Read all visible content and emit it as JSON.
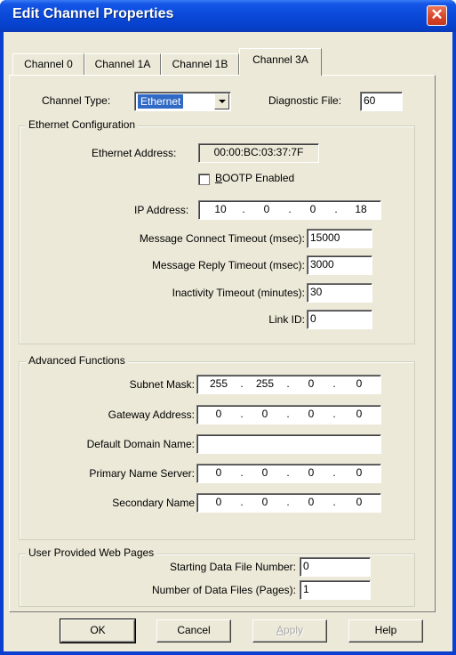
{
  "window": {
    "title": "Edit Channel Properties",
    "close_glyph": "✕"
  },
  "tabs": [
    {
      "label": "Channel 0"
    },
    {
      "label": "Channel 1A"
    },
    {
      "label": "Channel 1B"
    },
    {
      "label": "Channel 3A"
    }
  ],
  "channel": {
    "type_label": "Channel Type:",
    "type_value": "Ethernet",
    "diag_label": "Diagnostic File:",
    "diag_value": "60"
  },
  "ethernet": {
    "group_title": "Ethernet Configuration",
    "address_label": "Ethernet Address:",
    "address_value": "00:00:BC:03:37:7F",
    "bootp_first": "B",
    "bootp_rest": "OOTP Enabled",
    "bootp_checked": false,
    "ip_label": "IP Address:",
    "ip": [
      "10",
      "0",
      "0",
      "18"
    ],
    "connect_label": "Message Connect Timeout (msec):",
    "connect_value": "15000",
    "reply_label": "Message Reply Timeout (msec):",
    "reply_value": "3000",
    "inactivity_label": "Inactivity Timeout (minutes):",
    "inactivity_value": "30",
    "link_label": "Link ID:",
    "link_value": "0"
  },
  "advanced": {
    "group_title": "Advanced Functions",
    "subnet_label": "Subnet Mask:",
    "subnet": [
      "255",
      "255",
      "0",
      "0"
    ],
    "gateway_label": "Gateway Address:",
    "gateway": [
      "0",
      "0",
      "0",
      "0"
    ],
    "domain_label": "Default Domain Name:",
    "domain_value": "",
    "primary_label": "Primary Name Server:",
    "primary": [
      "0",
      "0",
      "0",
      "0"
    ],
    "secondary_label": "Secondary Name",
    "secondary": [
      "0",
      "0",
      "0",
      "0"
    ]
  },
  "web": {
    "group_title": "User Provided Web Pages",
    "start_label": "Starting Data File Number:",
    "start_value": "0",
    "count_label": "Number of Data Files (Pages):",
    "count_value": "1"
  },
  "buttons": {
    "ok": "OK",
    "cancel": "Cancel",
    "apply_first": "A",
    "apply_rest": "pply",
    "help": "Help"
  },
  "colors": {
    "title_bar": "#0a49d8",
    "dialog_bg": "#ece9d8",
    "selection": "#316ac5",
    "close_button": "#d9472b"
  }
}
